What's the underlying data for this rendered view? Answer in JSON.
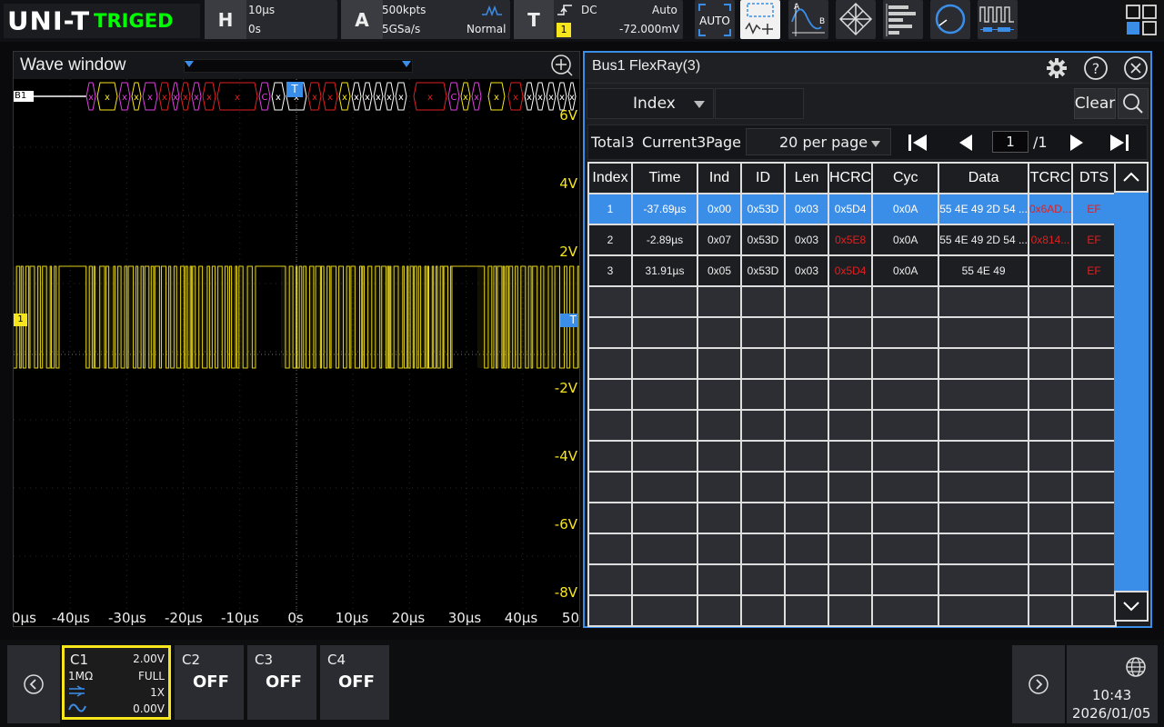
{
  "brand": {
    "logo": "UNI-T",
    "status": "TRIGED"
  },
  "horizontal": {
    "label": "H",
    "timebase": "10µs",
    "delay": "0s"
  },
  "acquire": {
    "label": "A",
    "memory": "500kpts",
    "sample_rate": "5GSa/s",
    "mode": "Normal"
  },
  "trigger": {
    "label": "T",
    "coupling": "DC",
    "sweep": "Auto",
    "source": "1",
    "level": "-72.000mV"
  },
  "toolbar": {
    "auto_label": "AUTO"
  },
  "wave_window": {
    "title": "Wave window",
    "bus_label": "B1",
    "channel_marker": "1",
    "trigger_marker": "T",
    "y_labels": [
      "6V",
      "4V",
      "2V",
      "-2V",
      "-4V",
      "-6V",
      "-8V"
    ],
    "x_labels": [
      "0µs",
      "-40µs",
      "-30µs",
      "-20µs",
      "-10µs",
      "0s",
      "10µs",
      "20µs",
      "30µs",
      "40µs",
      "50"
    ]
  },
  "decode": {
    "title": "Bus1 FlexRay(3)",
    "filter_field": "Index",
    "clear_label": "Clear",
    "total": "Total3",
    "current_page": "Current3Page",
    "per_page": "20 per page",
    "page": "1",
    "page_total": "/1",
    "columns": [
      "Index",
      "Time",
      "Ind",
      "ID",
      "Len",
      "HCRC",
      "Cyc",
      "Data",
      "TCRC",
      "DTS"
    ],
    "rows": [
      {
        "index": "1",
        "time": "-37.69µs",
        "ind": "0x00",
        "id": "0x53D",
        "len": "0x03",
        "hcrc": "0x5D4",
        "cyc": "0x0A",
        "data": "55 4E 49 2D 54 ...",
        "tcrc": "0x6AD...",
        "dts": "EF"
      },
      {
        "index": "2",
        "time": "-2.89µs",
        "ind": "0x07",
        "id": "0x53D",
        "len": "0x03",
        "hcrc": "0x5E8",
        "cyc": "0x0A",
        "data": "55 4E 49 2D 54 ...",
        "tcrc": "0x814...",
        "dts": "EF"
      },
      {
        "index": "3",
        "time": "31.91µs",
        "ind": "0x05",
        "id": "0x53D",
        "len": "0x03",
        "hcrc": "0x5D4",
        "cyc": "0x0A",
        "data": "55 4E 49",
        "tcrc": "",
        "dts": "EF"
      }
    ]
  },
  "channels": {
    "c1": {
      "name": "C1",
      "scale": "2.00V",
      "impedance": "1MΩ",
      "bandwidth": "FULL",
      "probe": "1X",
      "offset": "0.00V"
    },
    "c2": {
      "name": "C2",
      "state": "OFF"
    },
    "c3": {
      "name": "C3",
      "state": "OFF"
    },
    "c4": {
      "name": "C4",
      "state": "OFF"
    }
  },
  "clock": {
    "time": "10:43",
    "date": "2026/01/05"
  },
  "colors": {
    "ch1": "#f7e61c",
    "accent": "#3b8ee8",
    "bus_magenta": "#e040e0",
    "bus_red": "#e02020",
    "triged": "#00ff00"
  }
}
